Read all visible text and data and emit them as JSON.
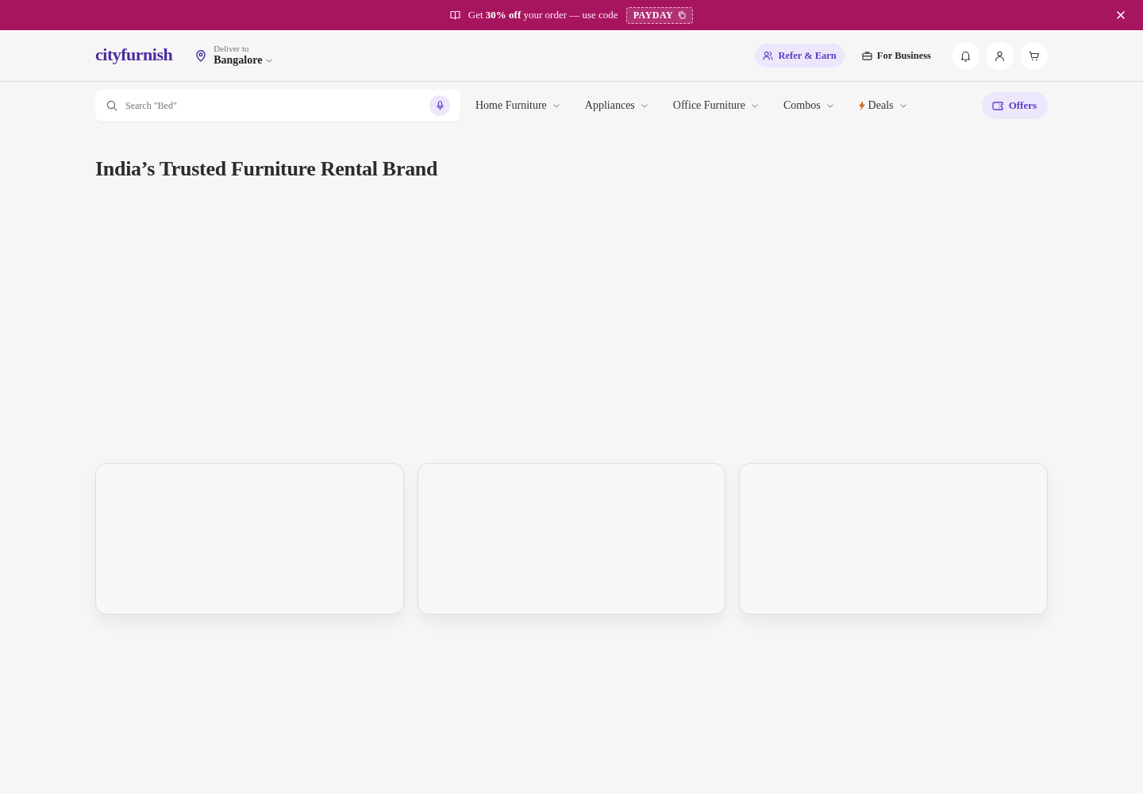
{
  "promo_bar": {
    "text": "Get **30% off** your order — use code",
    "code": "PAYDAY"
  },
  "header": {
    "logo": "cityfurnish",
    "deliver_label": "Deliver to",
    "city": "Bangalore",
    "actions": [
      {
        "label": "Refer & Earn",
        "kind": "refer"
      },
      {
        "label": "For Business",
        "kind": "business"
      }
    ]
  },
  "search": {
    "placeholder": "Search \"Bed\""
  },
  "nav": [
    {
      "label": "Home Furniture",
      "kind": "menu"
    },
    {
      "label": "Appliances",
      "kind": "menu"
    },
    {
      "label": "Office Furniture",
      "kind": "menu"
    },
    {
      "label": "Combos",
      "kind": "menu"
    },
    {
      "label": "Deals",
      "kind": "deals"
    }
  ],
  "offers_button": {
    "label": "Offers"
  },
  "hero": {
    "title": "India’s Trusted Furniture Rental Brand"
  }
}
